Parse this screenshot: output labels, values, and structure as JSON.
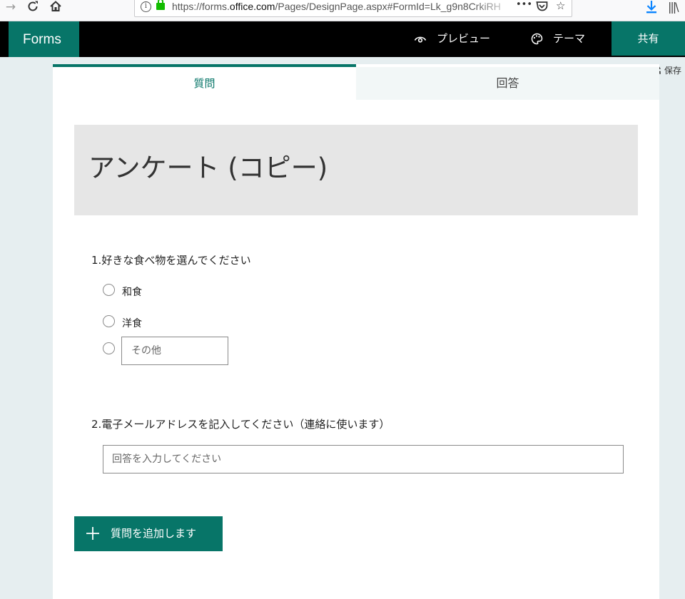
{
  "browser": {
    "url": "https://forms.office.com/Pages/DesignPage.aspx#FormId=Lk_g9n8CrkiRH",
    "url_prefix": "https://forms.",
    "url_domain": "office.com",
    "url_path": "/Pages/DesignPage.aspx#FormId=Lk_g9n8CrkiRH",
    "icons": [
      "forward-icon",
      "reload-icon",
      "home-icon",
      "info-icon",
      "lock-icon",
      "more-icon",
      "pocket-icon",
      "bookmark-star-icon",
      "download-icon",
      "library-icon"
    ],
    "more_glyph": "•••"
  },
  "app": {
    "brand": "Forms",
    "preview_label": "プレビュー",
    "theme_label": "テーマ",
    "share_label": "共有",
    "saved_label": "保存",
    "accent_color": "#077568"
  },
  "tabs": {
    "question": "質問",
    "response": "回答"
  },
  "form": {
    "title": "アンケート (コピー)",
    "questions": [
      {
        "number": "1.",
        "text": "好きな食べ物を選んでください",
        "options": [
          "和食",
          "洋食"
        ],
        "other_placeholder": "その他"
      },
      {
        "number": "2.",
        "text": "電子メールアドレスを記入してください（連絡に使います）",
        "answer_placeholder": "回答を入力してください"
      }
    ],
    "add_question_label": "質問を追加します"
  }
}
